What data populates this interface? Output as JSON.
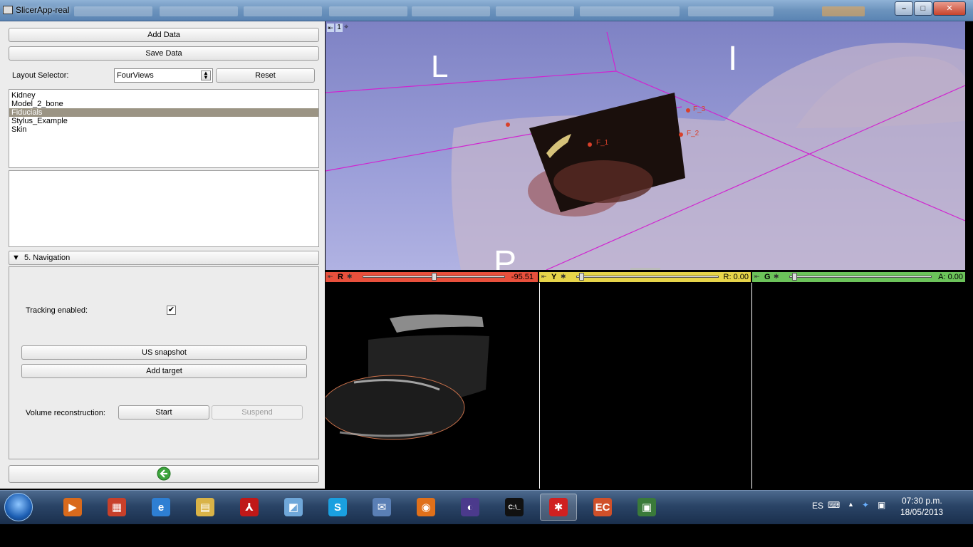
{
  "window": {
    "title": "SlicerApp-real"
  },
  "left_panel": {
    "add_data_label": "Add Data",
    "save_data_label": "Save Data",
    "layout_selector_label": "Layout Selector:",
    "layout_value": "FourViews",
    "reset_label": "Reset",
    "data_list": [
      {
        "label": "Kidney",
        "selected": false
      },
      {
        "label": "Model_2_bone",
        "selected": false
      },
      {
        "label": "Fiducials",
        "selected": true
      },
      {
        "label": "Stylus_Example",
        "selected": false
      },
      {
        "label": "Skin",
        "selected": false
      }
    ],
    "navigation_header": "5. Navigation",
    "tracking_label": "Tracking enabled:",
    "tracking_checked": true,
    "us_snapshot_label": "US snapshot",
    "add_target_label": "Add target",
    "volume_recon_label": "Volume reconstruction:",
    "start_label": "Start",
    "suspend_label": "Suspend"
  },
  "view3d": {
    "layout_number": "1",
    "orientation_markers": [
      "L",
      "I",
      "P"
    ],
    "fiducials": [
      "F_1",
      "F_2",
      "F_3"
    ]
  },
  "slice_views": [
    {
      "tag": "R",
      "color": "#e8503c",
      "value": "-95.51",
      "slider": 0.55
    },
    {
      "tag": "Y",
      "color": "#e6d44a",
      "value": "R: 0.00",
      "slider": 0.03
    },
    {
      "tag": "G",
      "color": "#6cc35a",
      "value": "A: 0.00",
      "slider": 0.03
    }
  ],
  "taskbar": {
    "items": [
      {
        "name": "media-player-icon",
        "glyph": "▶",
        "color": "#d96a1c"
      },
      {
        "name": "paint-icon",
        "glyph": "▦",
        "color": "#c8402a"
      },
      {
        "name": "internet-explorer-icon",
        "glyph": "e",
        "color": "#2e7fd3"
      },
      {
        "name": "file-explorer-icon",
        "glyph": "▤",
        "color": "#d9b347"
      },
      {
        "name": "acrobat-icon",
        "glyph": "⅄",
        "color": "#c01818"
      },
      {
        "name": "notes-icon",
        "glyph": "◩",
        "color": "#6fa7d9"
      },
      {
        "name": "skype-icon",
        "glyph": "S",
        "color": "#1aa0e0"
      },
      {
        "name": "thunderbird-icon",
        "glyph": "✉",
        "color": "#5a7fb5"
      },
      {
        "name": "firefox-icon",
        "glyph": "◉",
        "color": "#e0701a"
      },
      {
        "name": "eclipse-icon",
        "glyph": "◐",
        "color": "#4b3a8c"
      },
      {
        "name": "command-prompt-icon",
        "glyph": "C:\\_",
        "color": "#111111"
      },
      {
        "name": "slicer-icon",
        "glyph": "✱",
        "color": "#d02020"
      },
      {
        "name": "presentation-icon",
        "glyph": "EC",
        "color": "#d0502a"
      },
      {
        "name": "window-app-icon",
        "glyph": "▣",
        "color": "#3a7a3a"
      }
    ],
    "language": "ES",
    "time": "07:30 p.m.",
    "date": "18/05/2013"
  }
}
